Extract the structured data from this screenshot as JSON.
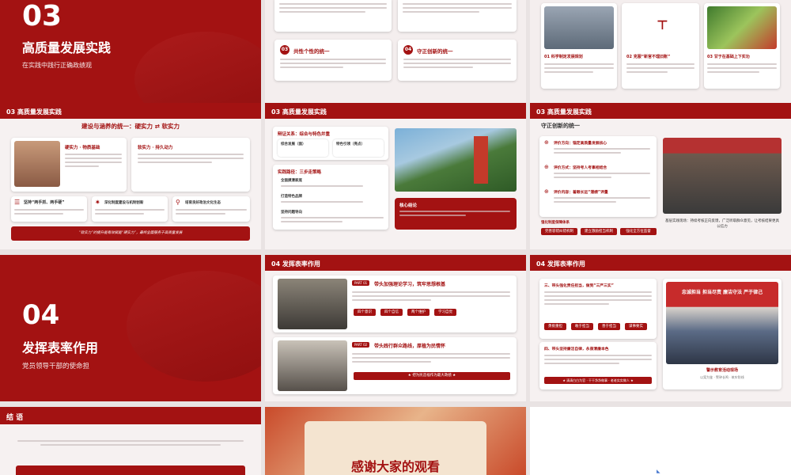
{
  "s1": {
    "number": "03",
    "title": "高质量发展实践",
    "subtitle": "在实践中践行正确政绩观"
  },
  "s2": {
    "c3_title": "共性个性的统一",
    "c4_title": "守正创新的统一"
  },
  "s3": {
    "captions": [
      "01 科学制定发展规划",
      "02 克服“新官不理旧账”",
      "03 甘于在基础上下实功"
    ]
  },
  "s4": {
    "header": "03 高质量发展实践",
    "heading": "建设与涵养的统一：硬实力 ⇄ 软实力",
    "hard_title": "硬实力 · 物质基础",
    "soft_title": "软实力 · 持久动力",
    "items": [
      "坚持“两手抓、两手硬”",
      "深化制度建设与机制创新",
      "培育良好政治文化生态"
    ],
    "banner": "“软实力”的提升能有效赋能“硬实力”，最终全面服务于高质量发展"
  },
  "s5": {
    "header": "03 高质量发展实践",
    "section_title": "辩证关系：综合与特色并重",
    "box1": "综合发展（面）",
    "box2": "特色引领（亮点）",
    "practice_title": "实践路径：三步走策略",
    "steps": [
      "全面摸清家底",
      "打造特色品牌",
      "坚持问题导向"
    ],
    "core_title": "核心结论"
  },
  "s6": {
    "header": "03 高质量发展实践",
    "heading": "守正创新的统一",
    "items": [
      "评价方向：锚定高质量发展核心",
      "评价方式：坚持考人考事相结合",
      "评价内容：着眼长远“潜绩”评量"
    ],
    "chip_title": "强化制度保障体系",
    "chips": [
      "完善容错纠错机制",
      "建立激励担当机制",
      "强化全方位监督"
    ],
    "caption": "基层实践现场：持续考核正向反馈，广泛听取群众意见，让考核结果更具公信力"
  },
  "s7": {
    "number": "04",
    "title": "发挥表率作用",
    "subtitle": "党员领导干部的使命担"
  },
  "s8": {
    "header": "04 发挥表率作用",
    "part1_tag": "PART 01",
    "part1_title": "带头加强理论学习，筑牢思想根基",
    "part1_pills": [
      "四个意识",
      "四个自信",
      "两个维护",
      "学习自觉"
    ],
    "part2_tag": "PART 02",
    "part2_title": "带头践行群众路线，厚植为民情怀",
    "part2_button": "★ 把为民造福作为最大政绩 ★"
  },
  "s9": {
    "header": "04 发挥表率作用",
    "sec3_title": "三、带头强化责任担当，做到“三严三实”",
    "pills": [
      "勇挑重担",
      "敢于担当",
      "善于担当",
      "谋事要实"
    ],
    "sec4_title": "四、带头坚持廉洁自律，永葆清廉本色",
    "banner": "★ 清清白白为官 · 干干净净做事 · 老老实实做人 ★",
    "photo_banner": "忠诚担当 担当尽责 廉洁守法 严于律己",
    "caption": "警示教育活动现场",
    "caption_sub": "以案为鉴 · 警钟长鸣 · 筑牢防线"
  },
  "s10": {
    "header": "结 语"
  },
  "s11": {
    "title": "感谢大家的观看"
  },
  "colors": {
    "brand_red": "#a31212",
    "light_red": "#c72b2b"
  }
}
